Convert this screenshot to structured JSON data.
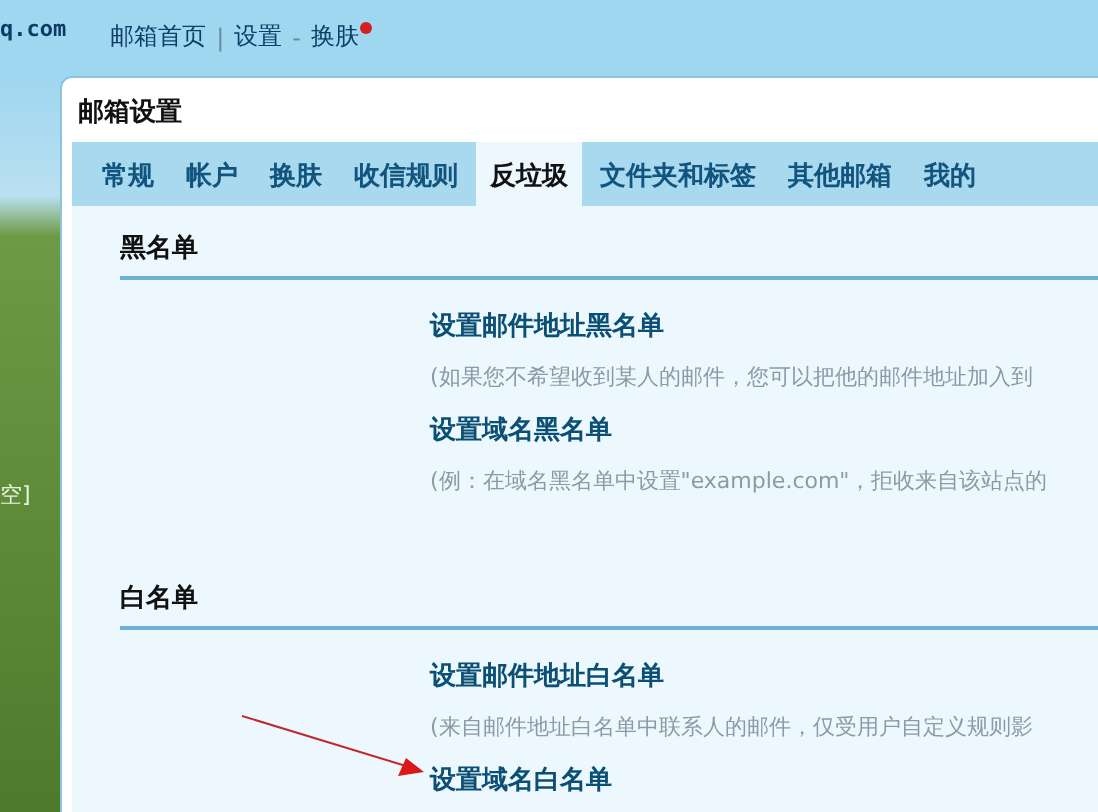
{
  "logo": {
    "text": "q.com"
  },
  "top_nav": {
    "items": [
      {
        "kind": "link",
        "label": "邮箱首页"
      },
      {
        "kind": "separator",
        "label": "|"
      },
      {
        "kind": "link",
        "label": "设置"
      },
      {
        "kind": "separator",
        "label": "-"
      },
      {
        "kind": "link",
        "label": "换肤",
        "notify": true
      }
    ]
  },
  "sidebar": {
    "text": "空]"
  },
  "window": {
    "title": "邮箱设置"
  },
  "tabs": [
    {
      "label": "常规",
      "selected": false
    },
    {
      "label": "帐户",
      "selected": false
    },
    {
      "label": "换肤",
      "selected": false
    },
    {
      "label": "收信规则",
      "selected": false
    },
    {
      "label": "反垃圾",
      "selected": true
    },
    {
      "label": "文件夹和标签",
      "selected": false
    },
    {
      "label": "其他邮箱",
      "selected": false
    },
    {
      "label": "我的",
      "selected": false
    }
  ],
  "sections": [
    {
      "title": "黑名单",
      "entries": [
        {
          "link": "设置邮件地址黑名单",
          "description": "(如果您不希望收到某人的邮件，您可以把他的邮件地址加入到"
        },
        {
          "link": "设置域名黑名单",
          "description": "(例：在域名黑名单中设置\"example.com\"，拒收来自该站点的"
        }
      ]
    },
    {
      "title": "白名单",
      "entries": [
        {
          "link": "设置邮件地址白名单",
          "description": "(来自邮件地址白名单中联系人的邮件，仅受用户自定义规则影"
        },
        {
          "link": "设置域名白名单",
          "arrow": true
        }
      ]
    }
  ]
}
